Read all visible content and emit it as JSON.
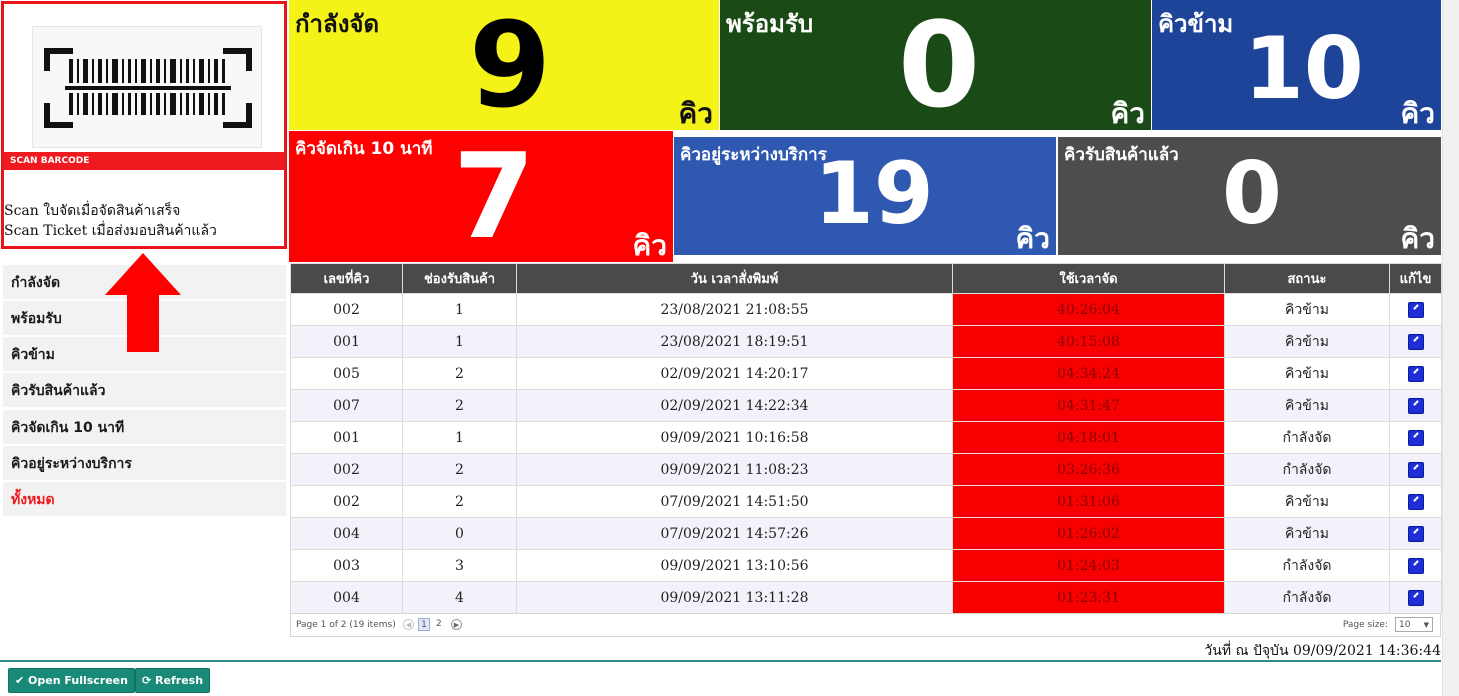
{
  "scan": {
    "header": "SCAN BARCODE",
    "line1": "Scan ใบจัดเมื่อจัดสินค้าเสร็จ",
    "line2": "Scan Ticket เมื่อส่งมอบสินค้าแล้ว"
  },
  "tiles": [
    {
      "label": "กำลังจัด",
      "value": "9",
      "unit": "คิว",
      "bg": "#f5f218"
    },
    {
      "label": "พร้อมรับ",
      "value": "0",
      "unit": "คิว",
      "bg": "#1a4a15"
    },
    {
      "label": "คิวข้าม",
      "value": "10",
      "unit": "คิว",
      "bg": "#1e4499"
    },
    {
      "label": "คิวจัดเกิน 10 นาที",
      "value": "7",
      "unit": "คิว",
      "bg": "#ff0000"
    },
    {
      "label": "คิวอยู่ระหว่างบริการ",
      "value": "19",
      "unit": "คิว",
      "bg": "#2f58b0"
    },
    {
      "label": "คิวรับสินค้าแล้ว",
      "value": "0",
      "unit": "คิว",
      "bg": "#4d4d4d"
    }
  ],
  "sidebar": {
    "items": [
      "กำลังจัด",
      "พร้อมรับ",
      "คิวข้าม",
      "คิวรับสินค้าแล้ว",
      "คิวจัดเกิน 10 นาที",
      "คิวอยู่ระหว่างบริการ",
      "ทั้งหมด"
    ]
  },
  "table": {
    "headers": [
      "เลขที่คิว",
      "ช่องรับสินค้า",
      "วัน เวลาสั่งพิมพ์",
      "ใช้เวลาจัด",
      "สถานะ",
      "แก้ไข"
    ],
    "rows": [
      [
        "002",
        "1",
        "23/08/2021 21:08:55",
        "40:26:04",
        "คิวข้าม"
      ],
      [
        "001",
        "1",
        "23/08/2021 18:19:51",
        "40:15:08",
        "คิวข้าม"
      ],
      [
        "005",
        "2",
        "02/09/2021 14:20:17",
        "04:34:24",
        "คิวข้าม"
      ],
      [
        "007",
        "2",
        "02/09/2021 14:22:34",
        "04:31:47",
        "คิวข้าม"
      ],
      [
        "001",
        "1",
        "09/09/2021 10:16:58",
        "04:18:01",
        "กำลังจัด"
      ],
      [
        "002",
        "2",
        "09/09/2021 11:08:23",
        "03:26:36",
        "กำลังจัด"
      ],
      [
        "002",
        "2",
        "07/09/2021 14:51:50",
        "01:31:06",
        "คิวข้าม"
      ],
      [
        "004",
        "0",
        "07/09/2021 14:57:26",
        "01:26:02",
        "คิวข้าม"
      ],
      [
        "003",
        "3",
        "09/09/2021 13:10:56",
        "01:24:03",
        "กำลังจัด"
      ],
      [
        "004",
        "4",
        "09/09/2021 13:11:28",
        "01:23:31",
        "กำลังจัด"
      ]
    ],
    "highlight_color": "#f70000"
  },
  "pager": {
    "info": "Page 1 of 2 (19 items)",
    "pages": [
      "1",
      "2"
    ],
    "size_label": "Page size:",
    "size_value": "10"
  },
  "footer": {
    "date_text": "วันที่ ณ ปัจุบัน 09/09/2021 14:36:44",
    "fullscreen_label": "Open Fullscreen",
    "refresh_label": "Refresh"
  }
}
